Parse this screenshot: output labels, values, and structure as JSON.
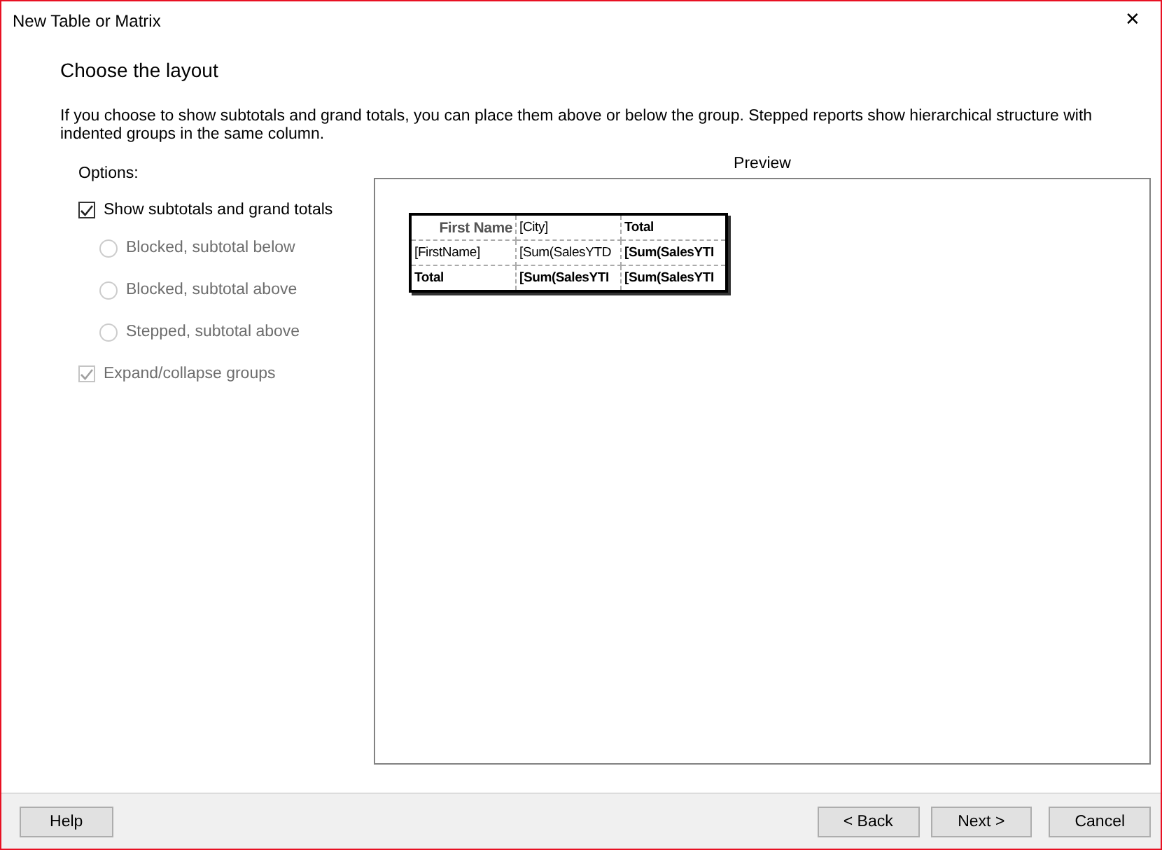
{
  "window": {
    "title": "New Table or Matrix",
    "close": "✕"
  },
  "heading": "Choose the layout",
  "description": "If you choose to show subtotals and grand totals, you can place them above or below the group. Stepped reports show hierarchical structure with indented groups in the same column.",
  "options": {
    "label": "Options:",
    "show_totals": {
      "label": "Show subtotals and grand totals",
      "checked": true,
      "disabled": false
    },
    "radios": [
      {
        "label": "Blocked, subtotal below",
        "selected": false,
        "disabled": true
      },
      {
        "label": "Blocked, subtotal above",
        "selected": false,
        "disabled": true
      },
      {
        "label": "Stepped, subtotal above",
        "selected": false,
        "disabled": true
      }
    ],
    "expand": {
      "label": "Expand/collapse groups",
      "checked": true,
      "disabled": true
    }
  },
  "preview": {
    "label": "Preview",
    "rows": [
      [
        {
          "text": "First Name",
          "bold": true,
          "kind": "header"
        },
        {
          "text": "[City]",
          "bold": false,
          "kind": "plain"
        },
        {
          "text": "Total",
          "bold": true,
          "kind": "plain"
        }
      ],
      [
        {
          "text": "[FirstName]",
          "bold": false,
          "kind": "plain"
        },
        {
          "text": "[Sum(SalesYTD",
          "bold": false,
          "kind": "plain"
        },
        {
          "text": "[Sum(SalesYTI",
          "bold": true,
          "kind": "plain"
        }
      ],
      [
        {
          "text": "Total",
          "bold": true,
          "kind": "plain"
        },
        {
          "text": "[Sum(SalesYTI",
          "bold": true,
          "kind": "plain"
        },
        {
          "text": "[Sum(SalesYTI",
          "bold": true,
          "kind": "plain"
        }
      ]
    ]
  },
  "buttons": {
    "help": "Help",
    "back": "< Back",
    "next": "Next >",
    "cancel": "Cancel"
  }
}
